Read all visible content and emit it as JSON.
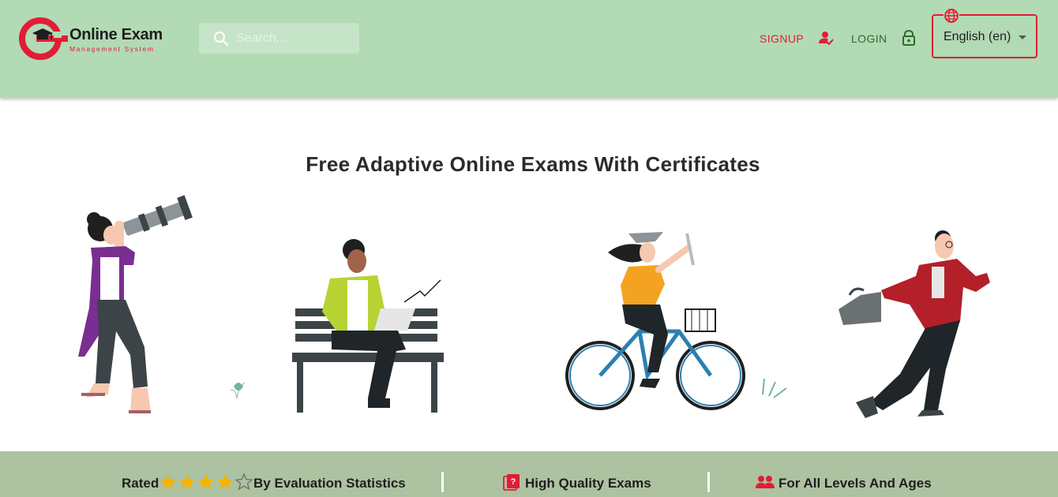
{
  "brand": {
    "title": "Online Exam",
    "subtitle": "Management System",
    "accent_color": "#e11d36",
    "header_bg": "#b2dab4"
  },
  "search": {
    "placeholder": "Search...",
    "value": "",
    "icon": "search-icon"
  },
  "nav": {
    "signup_label": "SIGNUP",
    "signup_icon": "user-check-icon",
    "login_label": "LOGIN",
    "login_icon": "lock-icon"
  },
  "language": {
    "selected": "English (en)",
    "icon": "globe-icon"
  },
  "hero": {
    "title": "Free Adaptive Online Exams With Certificates",
    "illustrations": [
      "woman-telescope",
      "man-laptop-bench",
      "graduate-bicycle",
      "businessman-running"
    ]
  },
  "features": {
    "rated_label": "Rated",
    "rating_stars": 4,
    "rating_max": 5,
    "rated_suffix": "By Evaluation Statistics",
    "quality_label": "High Quality Exams",
    "quality_icon": "question-book-icon",
    "levels_label": "For All Levels And Ages",
    "levels_icon": "people-icon",
    "bar_color": "#adc2a0"
  }
}
